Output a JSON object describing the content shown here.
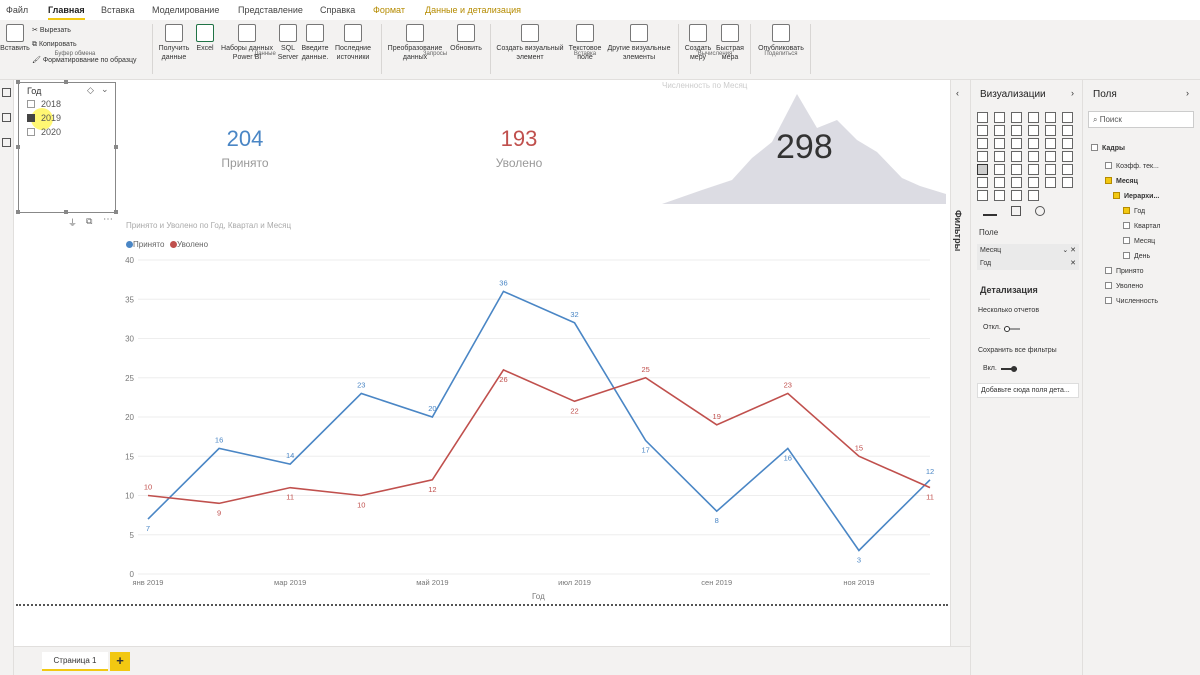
{
  "ribbon": {
    "tabs": [
      "Файл",
      "Главная",
      "Вставка",
      "Моделирование",
      "Представление",
      "Справка",
      "Формат",
      "Данные и детализация"
    ],
    "clipboard": {
      "paste": "Вставить",
      "cut": "Вырезать",
      "copy": "Копировать",
      "format_painter": "Форматирование по образцу",
      "group": "Буфер обмена"
    },
    "data": {
      "get_data": "Получить данные",
      "excel": "Excel",
      "pbi_datasets": "Наборы данных Power BI",
      "sql": "SQL Server",
      "enter_data": "Введите данные.",
      "recent": "Последние источники",
      "group": "Данные"
    },
    "queries": {
      "transform": "Преобразование данных",
      "refresh": "Обновить",
      "group": "Запросы"
    },
    "insert": {
      "new_visual": "Создать визуальный элемент",
      "text_box": "Текстовое поле",
      "more_visuals": "Другие визуальные элементы",
      "group": "Вставка"
    },
    "calculations": {
      "new_measure": "Создать меру",
      "quick_measure": "Быстрая мера",
      "group": "Вычисления"
    },
    "share": {
      "publish": "Опубликовать",
      "group": "Поделиться"
    }
  },
  "slicer": {
    "title": "Год",
    "items": [
      {
        "label": "2018",
        "checked": false
      },
      {
        "label": "2019",
        "checked": true
      },
      {
        "label": "2020",
        "checked": false
      }
    ]
  },
  "cards": [
    {
      "value": "204",
      "label": "Принято",
      "color": "#4a86c5"
    },
    {
      "value": "193",
      "label": "Уволено",
      "color": "#c0504d"
    }
  ],
  "area_card": {
    "title": "Численность по Месяц",
    "value": "298"
  },
  "chart_data": {
    "type": "line",
    "title": "Принято и Уволено по Год, Квартал и Месяц",
    "xlabel": "Год",
    "ylabel": "",
    "ylim": [
      0,
      40
    ],
    "yticks": [
      0,
      5,
      10,
      15,
      20,
      25,
      30,
      35,
      40
    ],
    "x": [
      "янв 2019",
      "фев 2019",
      "мар 2019",
      "апр 2019",
      "май 2019",
      "июн 2019",
      "июл 2019",
      "авг 2019",
      "сен 2019",
      "окт 2019",
      "ноя 2019",
      "дек 2019"
    ],
    "x_tick_labels": [
      "янв 2019",
      "мар 2019",
      "май 2019",
      "июл 2019",
      "сен 2019",
      "ноя 2019"
    ],
    "legend_position": "top-left",
    "grid": true,
    "series": [
      {
        "name": "Принято",
        "color": "#4a86c5",
        "values": [
          7,
          16,
          14,
          23,
          20,
          36,
          32,
          17,
          8,
          16,
          3,
          12
        ]
      },
      {
        "name": "Уволено",
        "color": "#c0504d",
        "values": [
          10,
          9,
          11,
          10,
          12,
          26,
          22,
          25,
          19,
          23,
          15,
          11
        ]
      }
    ]
  },
  "filters_pane": {
    "label": "Фильтры"
  },
  "viz_pane": {
    "title": "Визуализации",
    "field_section": "Поле",
    "wells": [
      "Месяц",
      "Год"
    ],
    "drillthrough_title": "Детализация",
    "cross_report_label": "Несколько отчетов",
    "cross_report_state": "Откл.",
    "keep_filters_label": "Сохранить все фильтры",
    "keep_filters_state": "Вкл.",
    "drill_placeholder": "Добавьте сюда поля дета..."
  },
  "fields_pane": {
    "title": "Поля",
    "search_placeholder": "Поиск",
    "tree": [
      {
        "label": "Кадры",
        "checked": false
      },
      {
        "label": "Коэфф. тек...",
        "checked": false
      },
      {
        "label": "Месяц",
        "checked": true
      },
      {
        "label": "Иерархи...",
        "checked": true
      },
      {
        "label": "Год",
        "checked": true
      },
      {
        "label": "Квартал",
        "checked": false
      },
      {
        "label": "Месяц",
        "checked": false
      },
      {
        "label": "День",
        "checked": false
      },
      {
        "label": "Принято",
        "checked": false
      },
      {
        "label": "Уволено",
        "checked": false
      },
      {
        "label": "Численность",
        "checked": false
      }
    ]
  },
  "pages": {
    "current": "Страница 1",
    "add": "+"
  }
}
